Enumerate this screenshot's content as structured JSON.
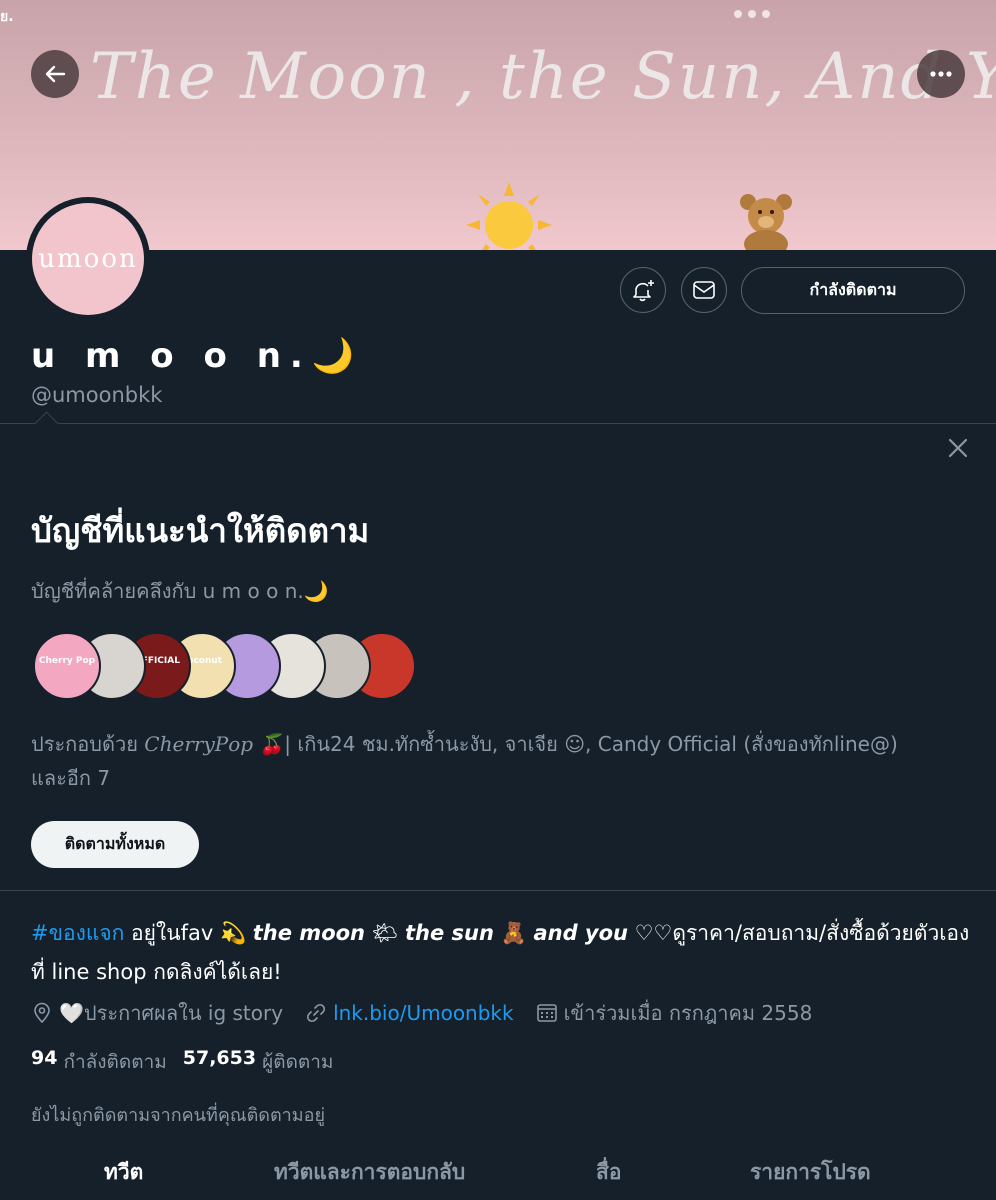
{
  "status": {
    "left": "ย."
  },
  "banner": {
    "title": "The Moon , the Sun, And You"
  },
  "avatar": {
    "text": "umoon"
  },
  "profile": {
    "display_name": "u m o o n.🌙",
    "handle": "@umoonbkk",
    "following_button": "กำลังติดตาม"
  },
  "suggestions": {
    "title": "บัญชีที่แนะนำให้ติดตาม",
    "subtitle": "บัญชีที่คล้ายคลึงกับ u m o o n.🌙",
    "avatars": [
      {
        "label": "Cherry Pop",
        "color": "#f4a7c0"
      },
      {
        "label": "",
        "color": "#d8d4cf"
      },
      {
        "label": "OFFICIAL",
        "color": "#7a1a1a"
      },
      {
        "label": "coconut",
        "color": "#f3e0b0"
      },
      {
        "label": "",
        "color": "#b69ae0"
      },
      {
        "label": "",
        "color": "#e6e2dc"
      },
      {
        "label": "",
        "color": "#c8c2bd"
      },
      {
        "label": "",
        "color": "#c8372a"
      }
    ],
    "description_prefix": "ประกอบด้วย ",
    "description_name": "𝐶ℎ𝑒𝑟𝑟𝑦𝑃𝑜𝑝 🍒",
    "description_rest": "| เกิน24 ชม.ทักซ้ำนะงับ, จาเจีย ☺︎, Candy Official (สั่งของทักline@)",
    "description_more": "และอีก 7",
    "follow_all_button": "ติดตามทั้งหมด"
  },
  "bio": {
    "hashtag": "#ของแจก",
    "text1": " อยู่ในfav 💫 ",
    "moon": "𝙩𝙝𝙚 𝙢𝙤𝙤𝙣",
    "text2": " 🌤 ",
    "sun": "𝙩𝙝𝙚 𝙨𝙪𝙣",
    "text3": " 🧸 ",
    "you": "𝙖𝙣𝙙 𝙮𝙤𝙪",
    "text4": " ♡♡ดูราคา/สอบถาม/สั่งซื้อด้วยตัวเองที่ line shop กดลิงค์ได้เลย!"
  },
  "meta": {
    "location": "🤍ประกาศผลใน ig story",
    "link": "lnk.bio/Umoonbkk",
    "joined": "เข้าร่วมเมื่อ กรกฎาคม 2558"
  },
  "stats": {
    "following_count": "94",
    "following_label": "กำลังติดตาม",
    "followers_count": "57,653",
    "followers_label": "ผู้ติดตาม"
  },
  "not_followed": "ยังไม่ถูกติดตามจากคนที่คุณติดตามอยู่",
  "tabs": [
    {
      "label": "ทวีต"
    },
    {
      "label": "ทวีตและการตอบกลับ"
    },
    {
      "label": "สื่อ"
    },
    {
      "label": "รายการโปรด"
    }
  ],
  "colors": {
    "background": "#15202b",
    "accent": "#1d9bf0",
    "muted": "#8b98a5",
    "banner": "#dcb6bb"
  }
}
